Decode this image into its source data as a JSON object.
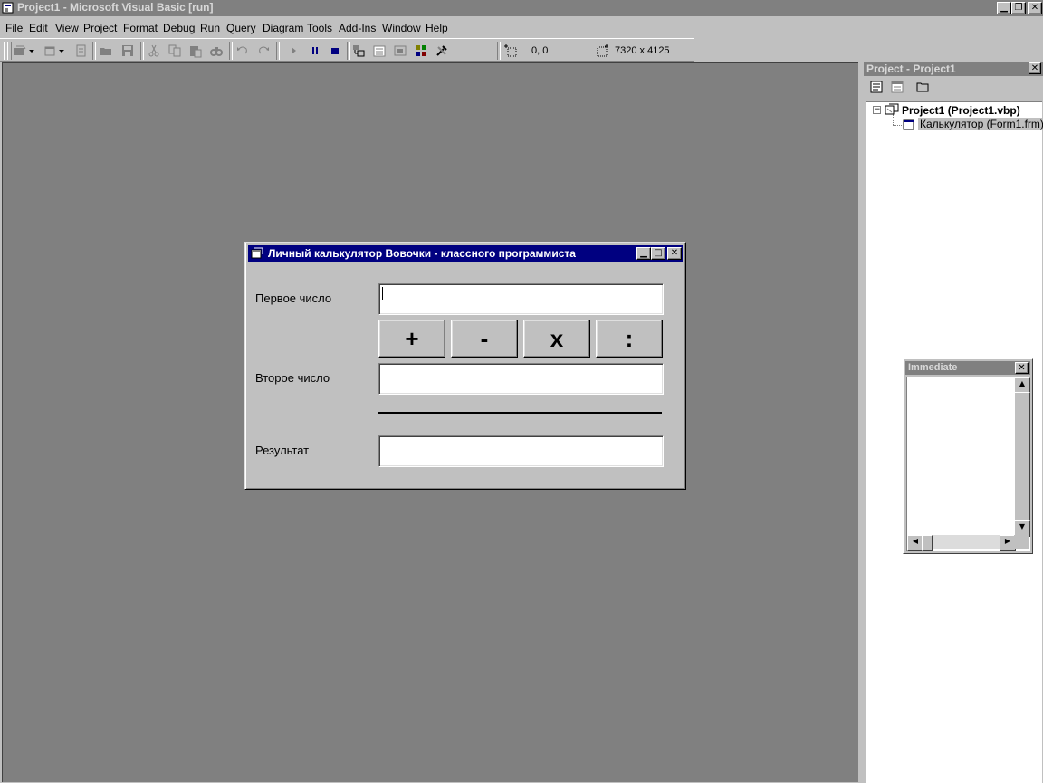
{
  "window": {
    "title": "Project1 - Microsoft Visual Basic [run]"
  },
  "menu": {
    "file": "File",
    "edit": "Edit",
    "view": "View",
    "project": "Project",
    "format": "Format",
    "debug": "Debug",
    "run": "Run",
    "query": "Query",
    "diagram": "Diagram",
    "tools": "Tools",
    "addins": "Add-Ins",
    "window": "Window",
    "help": "Help"
  },
  "toolbar": {
    "position": "0, 0",
    "size": "7320 x 4125"
  },
  "project_panel": {
    "title": "Project - Project1",
    "project_node": "Project1 (Project1.vbp)",
    "form_node": "Калькулятор (Form1.frm)"
  },
  "immediate": {
    "title": "Immediate"
  },
  "form": {
    "title": "Личный калькулятор Вовочки - классного программиста",
    "first_label": "Первое число",
    "second_label": "Второе число",
    "result_label": "Результат",
    "first_value": "",
    "second_value": "",
    "result_value": "",
    "btn_add": "+",
    "btn_sub": "-",
    "btn_mul": "x",
    "btn_div": ":"
  },
  "colors": {
    "workspace": "#808080",
    "face": "#c0c0c0",
    "active_caption": "#000080",
    "inactive_caption": "#808080"
  }
}
